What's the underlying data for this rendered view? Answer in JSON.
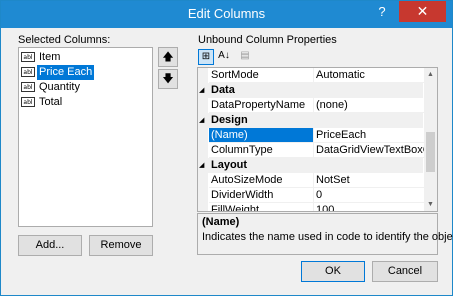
{
  "window": {
    "title": "Edit Columns",
    "help_label": "?",
    "close_label": "✕"
  },
  "selected_columns": {
    "label": "Selected Columns:",
    "items": [
      {
        "label": "Item",
        "icon": "abl",
        "selected": false
      },
      {
        "label": "Price Each",
        "icon": "abl",
        "selected": true
      },
      {
        "label": "Quantity",
        "icon": "abl",
        "selected": false
      },
      {
        "label": "Total",
        "icon": "abl",
        "selected": false
      }
    ],
    "move_up": "🡅",
    "move_down": "🡇",
    "add_label": "Add...",
    "remove_label": "Remove"
  },
  "properties": {
    "label": "Unbound Column Properties",
    "toolbar": {
      "categorized": "⊞",
      "alphabetical": "A↓",
      "pages": "▤"
    },
    "rows": [
      {
        "type": "prop",
        "name": "SortMode",
        "value": "Automatic"
      },
      {
        "type": "cat",
        "name": "Data"
      },
      {
        "type": "prop",
        "name": "DataPropertyName",
        "value": "(none)"
      },
      {
        "type": "cat",
        "name": "Design"
      },
      {
        "type": "prop",
        "name": "(Name)",
        "value": "PriceEach",
        "selected": true
      },
      {
        "type": "prop",
        "name": "ColumnType",
        "value": "DataGridViewTextBoxColum"
      },
      {
        "type": "cat",
        "name": "Layout"
      },
      {
        "type": "prop",
        "name": "AutoSizeMode",
        "value": "NotSet"
      },
      {
        "type": "prop",
        "name": "DividerWidth",
        "value": "0"
      },
      {
        "type": "prop",
        "name": "FillWeight",
        "value": "100"
      }
    ],
    "description": {
      "title": "(Name)",
      "text": "Indicates the name used in code to identify the object."
    }
  },
  "buttons": {
    "ok": "OK",
    "cancel": "Cancel"
  },
  "colors": {
    "titlebar": "#1f8ad2",
    "close": "#c7382f",
    "selection": "#0078d7"
  }
}
